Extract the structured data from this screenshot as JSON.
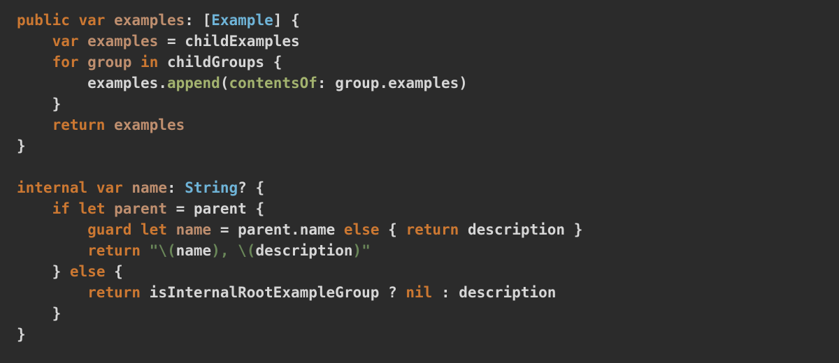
{
  "code": {
    "l1": {
      "kw_public": "public",
      "kw_var": "var",
      "name": "examples",
      "colon": ":",
      "lbr": "[",
      "type": "Example",
      "rbr": "]",
      "ob": "{"
    },
    "l2": {
      "kw_var": "var",
      "name": "examples",
      "eq": "=",
      "rhs": "childExamples"
    },
    "l3": {
      "kw_for": "for",
      "item": "group",
      "kw_in": "in",
      "seq": "childGroups",
      "ob": "{"
    },
    "l4": {
      "recv": "examples",
      "dot": ".",
      "fn": "append",
      "lp": "(",
      "label": "contentsOf",
      "colon": ":",
      "arg_recv": "group",
      "dot2": ".",
      "arg_prop": "examples",
      "rp": ")"
    },
    "l5": {
      "cb": "}"
    },
    "l6": {
      "kw_return": "return",
      "val": "examples"
    },
    "l7": {
      "cb": "}"
    },
    "l8": {
      "blank": ""
    },
    "l9": {
      "kw_internal": "internal",
      "kw_var": "var",
      "name": "name",
      "colon": ":",
      "type": "String",
      "q": "?",
      "ob": "{"
    },
    "l10": {
      "kw_if": "if",
      "kw_let": "let",
      "lname": "parent",
      "eq": "=",
      "rhs": "parent",
      "ob": "{"
    },
    "l11": {
      "kw_guard": "guard",
      "kw_let": "let",
      "lname": "name",
      "eq": "=",
      "recv": "parent",
      "dot": ".",
      "prop": "name",
      "kw_else": "else",
      "ob": "{",
      "kw_return": "return",
      "val": "description",
      "cb": "}"
    },
    "l12": {
      "kw_return": "return",
      "s_open": "\"",
      "s_esc1": "\\(",
      "s_id1": "name",
      "s_esc1c": ")",
      "s_mid": ", ",
      "s_esc2": "\\(",
      "s_id2": "description",
      "s_esc2c": ")",
      "s_close": "\""
    },
    "l13": {
      "cb": "}",
      "kw_else": "else",
      "ob": "{"
    },
    "l14": {
      "kw_return": "return",
      "cond": "isInternalRootExampleGroup",
      "q": "?",
      "kw_nil": "nil",
      "colon": ":",
      "alt": "description"
    },
    "l15": {
      "cb": "}"
    },
    "l16": {
      "cb": "}"
    }
  }
}
